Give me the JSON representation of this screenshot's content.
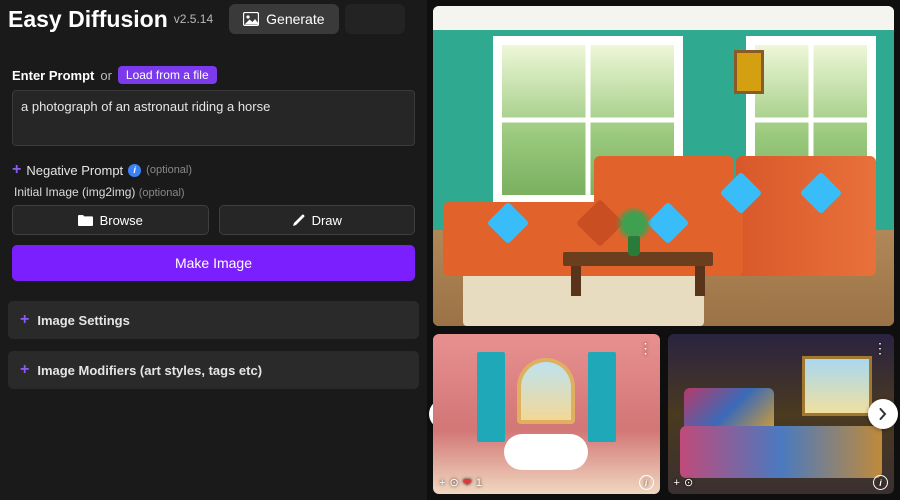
{
  "app": {
    "title": "Easy Diffusion",
    "version": "v2.5.14"
  },
  "tabs": {
    "generate": "Generate"
  },
  "prompt": {
    "label": "Enter Prompt",
    "or": "or",
    "load_chip": "Load from a file",
    "value": "a photograph of an astronaut riding a horse"
  },
  "negative": {
    "label": "Negative Prompt",
    "optional": "(optional)"
  },
  "initial_image": {
    "label": "Initial Image (img2img)",
    "optional": "(optional)",
    "browse": "Browse",
    "draw": "Draw"
  },
  "primary_action": "Make Image",
  "panels": {
    "image_settings": "Image Settings",
    "modifiers": "Image Modifiers (art styles, tags etc)"
  },
  "thumbs": {
    "likes_1": "1"
  },
  "colors": {
    "accent": "#7c1fff",
    "chip": "#7c3aed",
    "teal_wall": "#2fa98f",
    "sofa": "#e2622c"
  }
}
